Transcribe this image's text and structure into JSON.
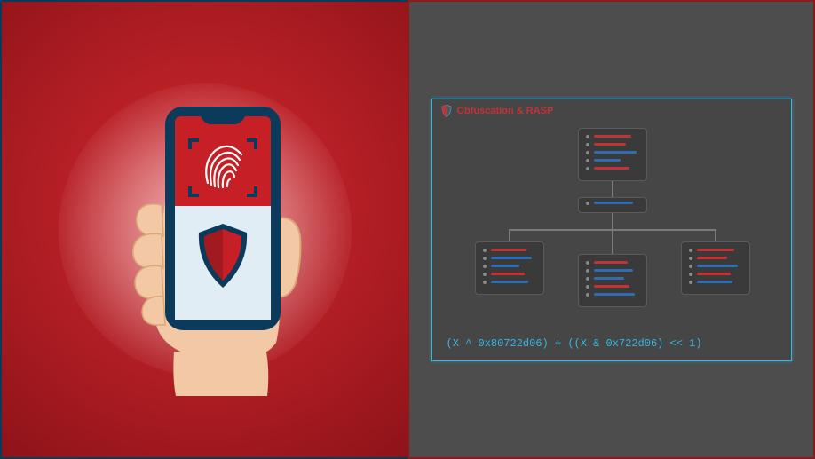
{
  "left": {
    "semantic": "hand-holding-phone-with-fingerprint-and-shield"
  },
  "right": {
    "title": "Obfuscation & RASP",
    "code": "(X ^ 0x80722d06) + ((X & 0x722d06) << 1)",
    "colors": {
      "accent_cyan": "#35b6e2",
      "accent_red": "#c23338",
      "accent_blue": "#2c6db5"
    },
    "tree": {
      "root": {
        "bars": [
          "red",
          "red",
          "blue",
          "blue",
          "red"
        ]
      },
      "connector": {
        "bars": [
          "blue"
        ]
      },
      "children": [
        {
          "bars": [
            "red",
            "blue",
            "blue",
            "red",
            "blue"
          ]
        },
        {
          "bars": [
            "red",
            "blue",
            "blue",
            "red",
            "blue"
          ]
        },
        {
          "bars": [
            "red",
            "red",
            "blue",
            "red",
            "blue"
          ]
        }
      ]
    }
  }
}
